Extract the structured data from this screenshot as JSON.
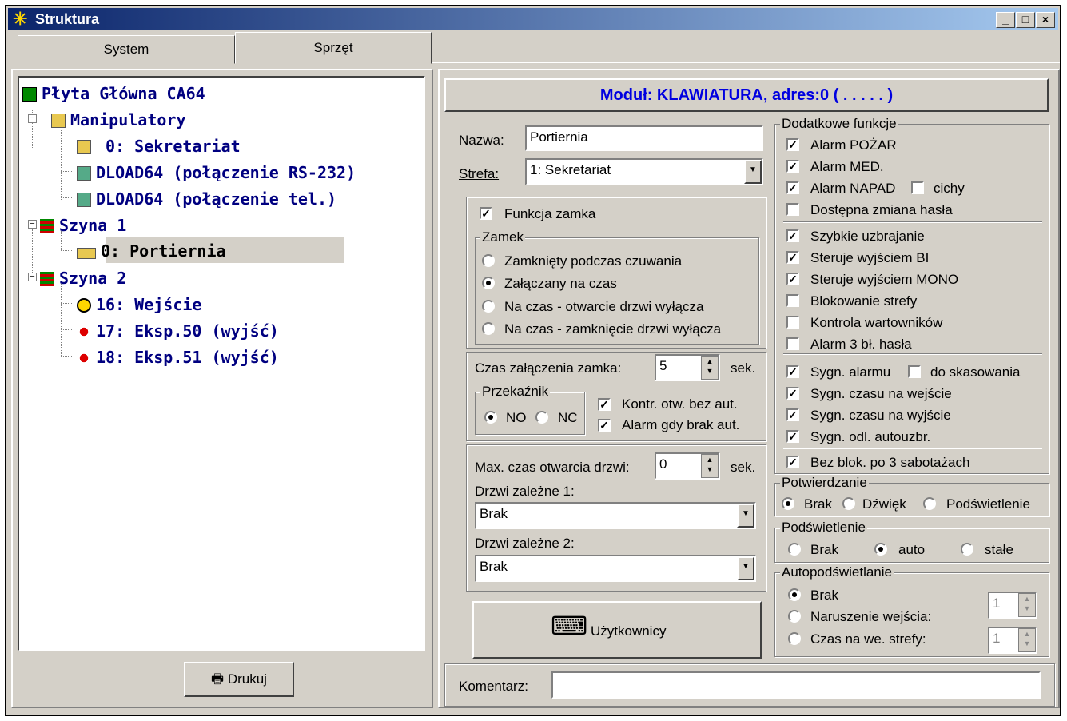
{
  "window": {
    "title": "Struktura",
    "min": "_",
    "max": "□",
    "close": "×"
  },
  "tabs": [
    "System",
    "Sprzęt"
  ],
  "tree": [
    {
      "label": "Płyta Główna CA64"
    },
    {
      "label": "Manipulatory"
    },
    {
      "label": "0: Sekretariat"
    },
    {
      "label": "DLOAD64 (połączenie RS-232)"
    },
    {
      "label": "DLOAD64 (połączenie tel.)"
    },
    {
      "label": "Szyna 1"
    },
    {
      "label": "0: Portiernia"
    },
    {
      "label": "Szyna 2"
    },
    {
      "label": "16: Wejście"
    },
    {
      "label": "17: Eksp.50 (wyjść)"
    },
    {
      "label": "18: Eksp.51 (wyjść)"
    }
  ],
  "print_button": "Drukuj",
  "module_header": "Moduł: KLAWIATURA, adres:0 ( . . . . . )",
  "form": {
    "name_label": "Nazwa:",
    "name_value": "Portiernia",
    "zone_label": "Strefa:",
    "zone_value": "1: Sekretariat",
    "lock_function": "Funkcja zamka",
    "lock_group": "Zamek",
    "lock_options": [
      "Zamknięty podczas czuwania",
      "Załączany na czas",
      "Na czas - otwarcie drzwi wyłącza",
      "Na czas - zamknięcie drzwi wyłącza"
    ],
    "lock_time_label": "Czas załączenia zamka:",
    "lock_time_value": "5",
    "sec": "sek.",
    "relay_group": "Przekaźnik",
    "relay_no": "NO",
    "relay_nc": "NC",
    "kontr": "Kontr. otw. bez aut.",
    "alarm_brak": "Alarm gdy brak aut.",
    "max_open_label": "Max. czas otwarcia drzwi:",
    "max_open_value": "0",
    "door1_label": "Drzwi zależne 1:",
    "door1_value": "Brak",
    "door2_label": "Drzwi zależne 2:",
    "door2_value": "Brak",
    "users_button": "Użytkownicy",
    "comment_label": "Komentarz:"
  },
  "extra": {
    "group": "Dodatkowe funkcje",
    "items1": [
      "Alarm POŻAR",
      "Alarm MED.",
      "Alarm NAPAD",
      "Dostępna zmiana hasła"
    ],
    "cichy": "cichy",
    "items2": [
      "Szybkie uzbrajanie",
      "Steruje wyjściem BI",
      "Steruje wyjściem MONO",
      "Blokowanie strefy",
      "Kontrola wartowników",
      "Alarm 3 bł. hasła"
    ],
    "items3": [
      "Sygn. alarmu",
      "Sygn. czasu na wejście",
      "Sygn. czasu na wyjście",
      "Sygn. odl. autouzbr."
    ],
    "do_skasowania": "do skasowania",
    "item4": "Bez blok. po 3 sabotażach"
  },
  "confirm": {
    "group": "Potwierdzanie",
    "o1": "Brak",
    "o2": "Dźwięk",
    "o3": "Podświetlenie"
  },
  "backlight": {
    "group": "Podświetlenie",
    "o1": "Brak",
    "o2": "auto",
    "o3": "stałe"
  },
  "autobacklight": {
    "group": "Autopodświetlanie",
    "o1": "Brak",
    "o2": "Naruszenie wejścia:",
    "o3": "Czas na we. strefy:",
    "v2": "1",
    "v3": "1"
  }
}
